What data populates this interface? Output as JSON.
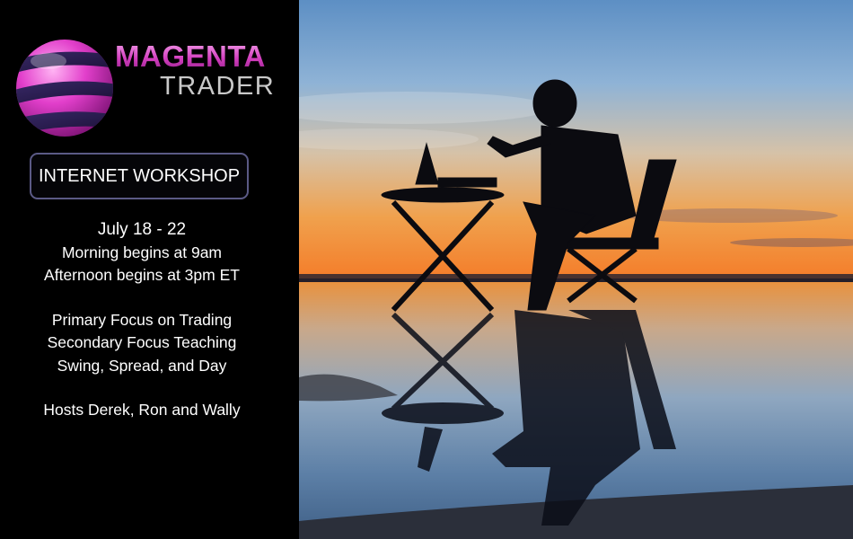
{
  "brand": {
    "line1": "MAGENTA",
    "line2": "TRADER"
  },
  "workshop_button": {
    "label": "INTERNET WORKSHOP"
  },
  "schedule": {
    "dates": "July 18 - 22",
    "morning": "Morning  begins at 9am",
    "afternoon": "Afternoon  begins at 3pm ET"
  },
  "focus": {
    "primary": "Primary Focus on Trading",
    "secondary": "Secondary Focus Teaching",
    "styles": "Swing, Spread, and Day"
  },
  "hosts": "Hosts Derek, Ron and Wally",
  "colors": {
    "brand_magenta": "#d43fc0",
    "button_border": "#5b5a86",
    "panel_background": "#000000"
  },
  "icons": {
    "logo": "striped-magenta-sphere-icon"
  }
}
